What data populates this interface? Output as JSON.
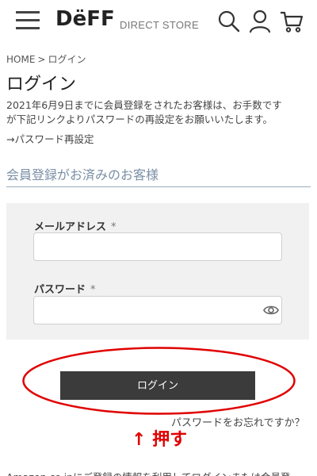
{
  "header": {
    "logo": "DëFF",
    "store_label": "DIRECT STORE",
    "icons": [
      "hamburger-menu-icon",
      "search-icon",
      "user-icon",
      "cart-icon"
    ]
  },
  "breadcrumb": {
    "home": "HOME",
    "separator": ">",
    "current": "ログイン"
  },
  "page_title": "ログイン",
  "notice": {
    "line1": "2021年6月9日までに会員登録をされたお客様は、お手数です",
    "line2": "が下記リンクよりパスワードの再設定をお願いいたします。",
    "reset_link": "→パスワード再設定"
  },
  "section_heading": "会員登録がお済みのお客様",
  "form": {
    "email_label": "メールアドレス",
    "password_label": "パスワード",
    "required_mark": "*",
    "email_value": "",
    "password_value": ""
  },
  "login_button": "ログイン",
  "forgot_link": "パスワードをお忘れですか？",
  "annotation": "↑ 押す",
  "amazon_text": "Amazon.co.jpにご登録の情報を利用してログインまたは会員登",
  "colors": {
    "button_bg": "#3b3b3b",
    "panel_bg": "#f1f1f1",
    "heading_blue": "#7a8fa6",
    "annotation_red": "#e00000"
  }
}
